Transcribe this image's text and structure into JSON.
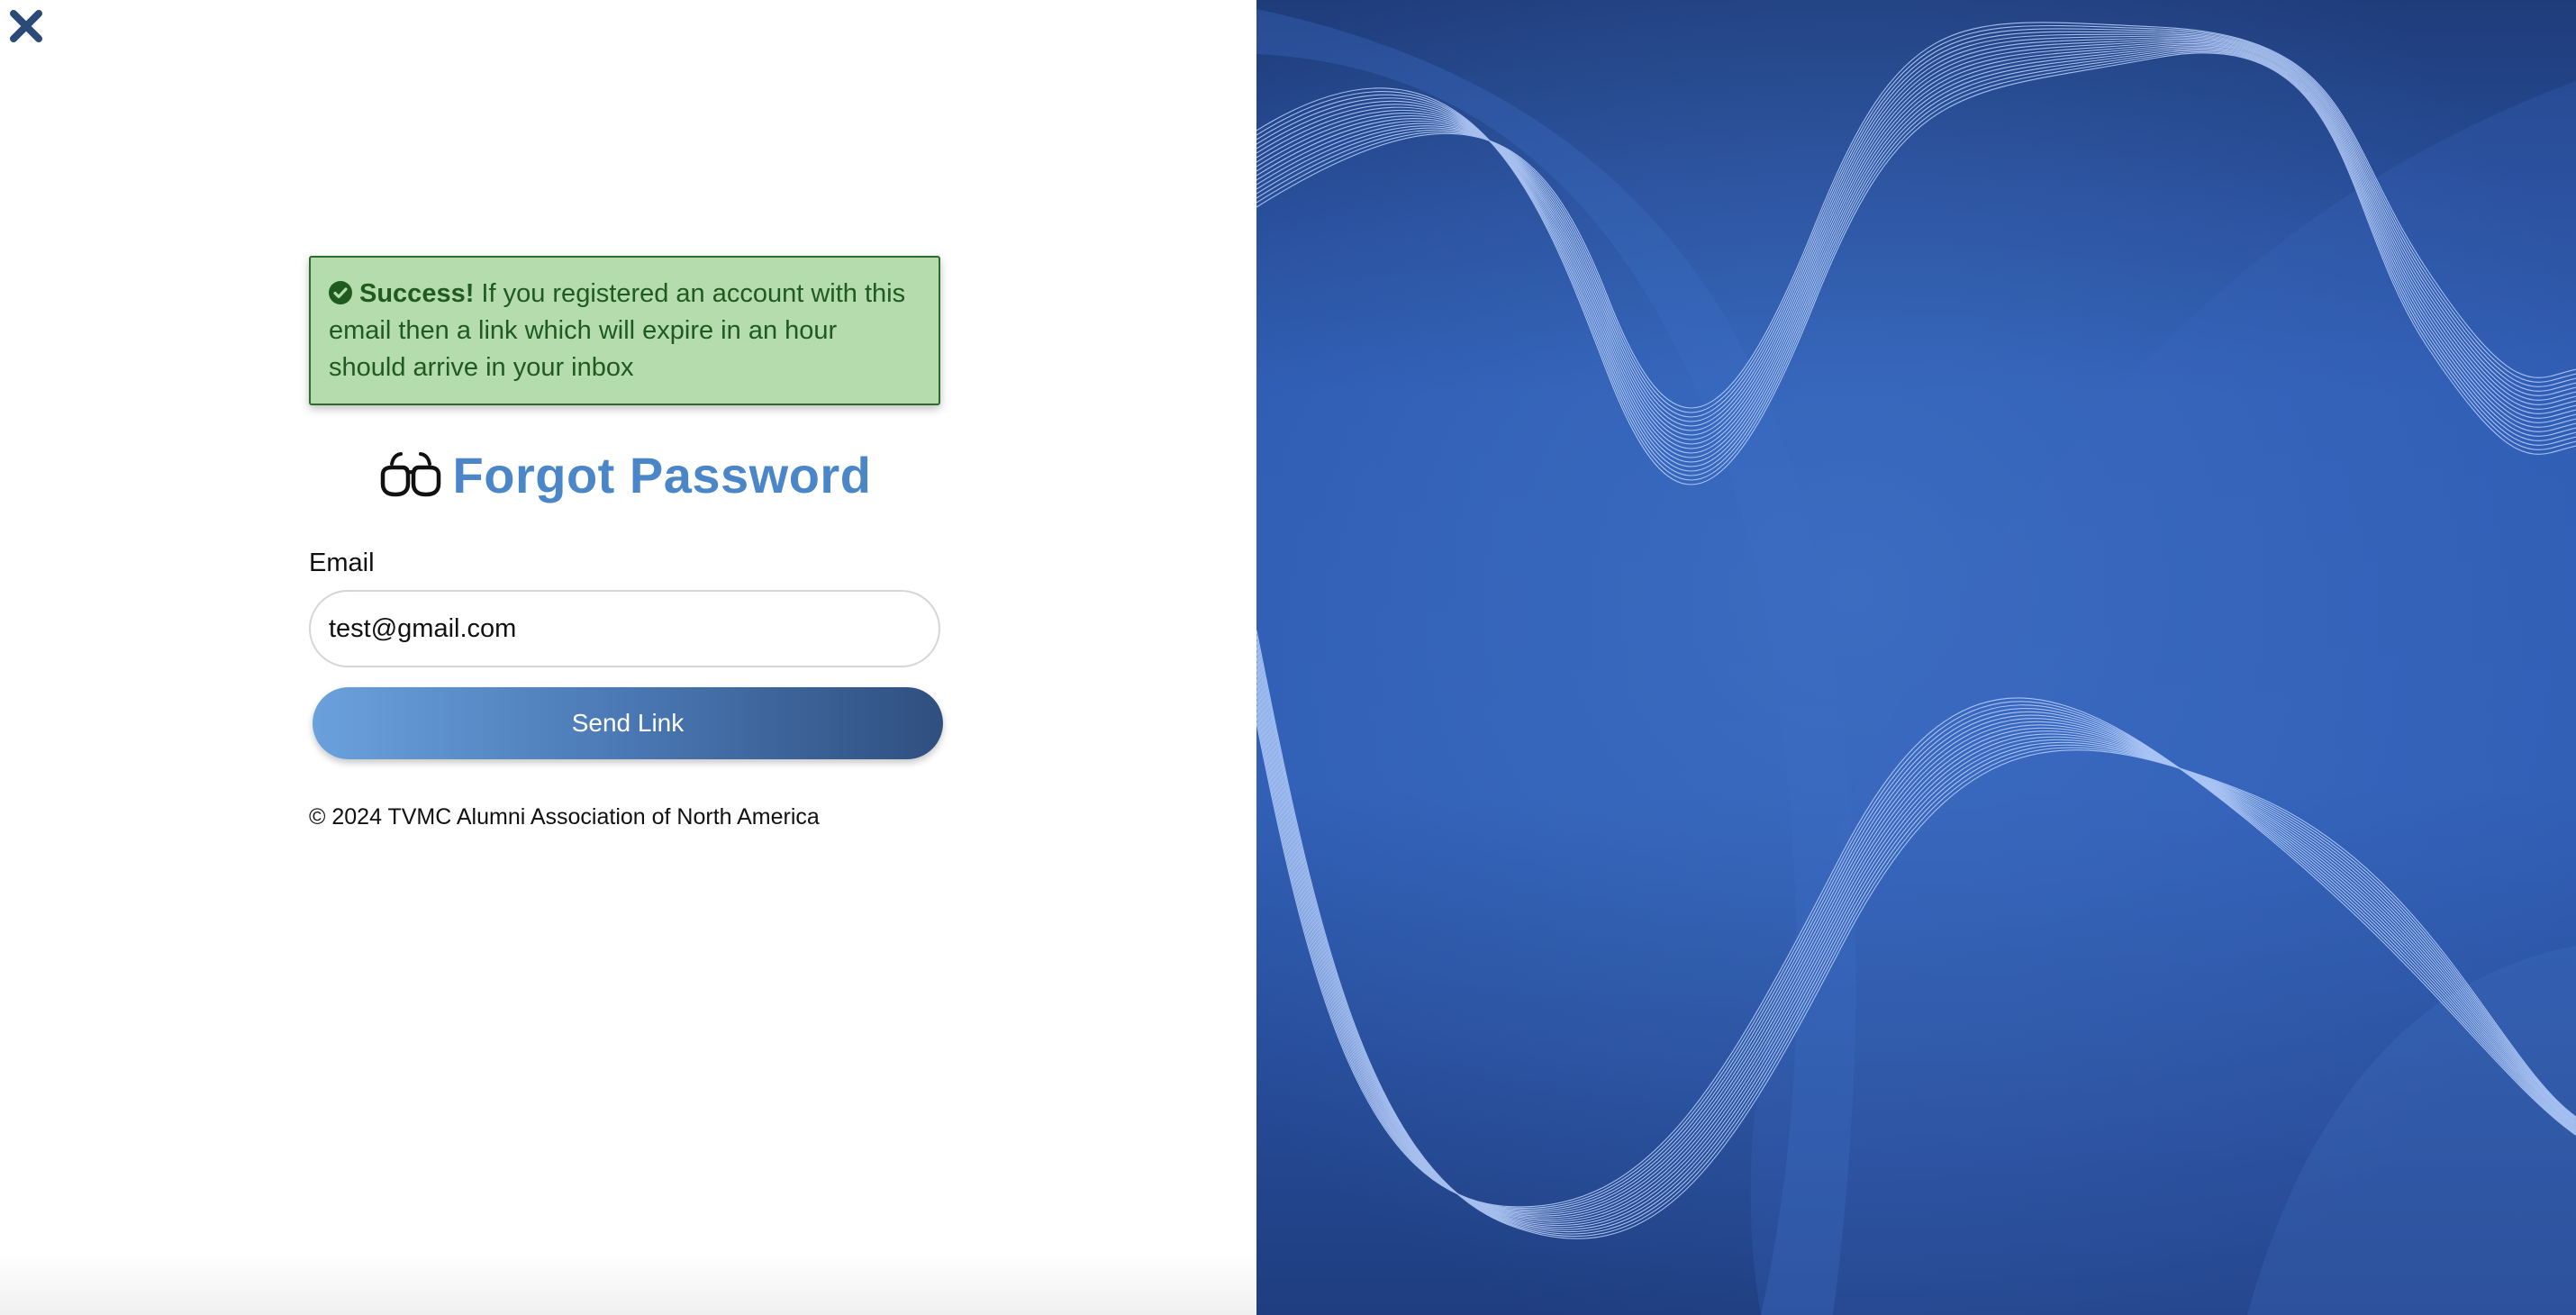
{
  "close": {
    "icon": "close-icon"
  },
  "alert": {
    "icon": "check-circle-icon",
    "strong": "Success!",
    "message": " If you registered an account with this email then a link which will expire in an hour should arrive in your inbox"
  },
  "header": {
    "icon": "glasses-icon",
    "title": "Forgot Password"
  },
  "form": {
    "email_label": "Email",
    "email_value": "test@gmail.com",
    "submit_label": "Send Link"
  },
  "footer": {
    "copyright": "© 2024 TVMC Alumni Association of North America"
  },
  "colors": {
    "accent": "#4a86c8",
    "success_bg": "#b5dcad",
    "success_text": "#1f5a1f",
    "panel_blue": "#2f58a8"
  }
}
